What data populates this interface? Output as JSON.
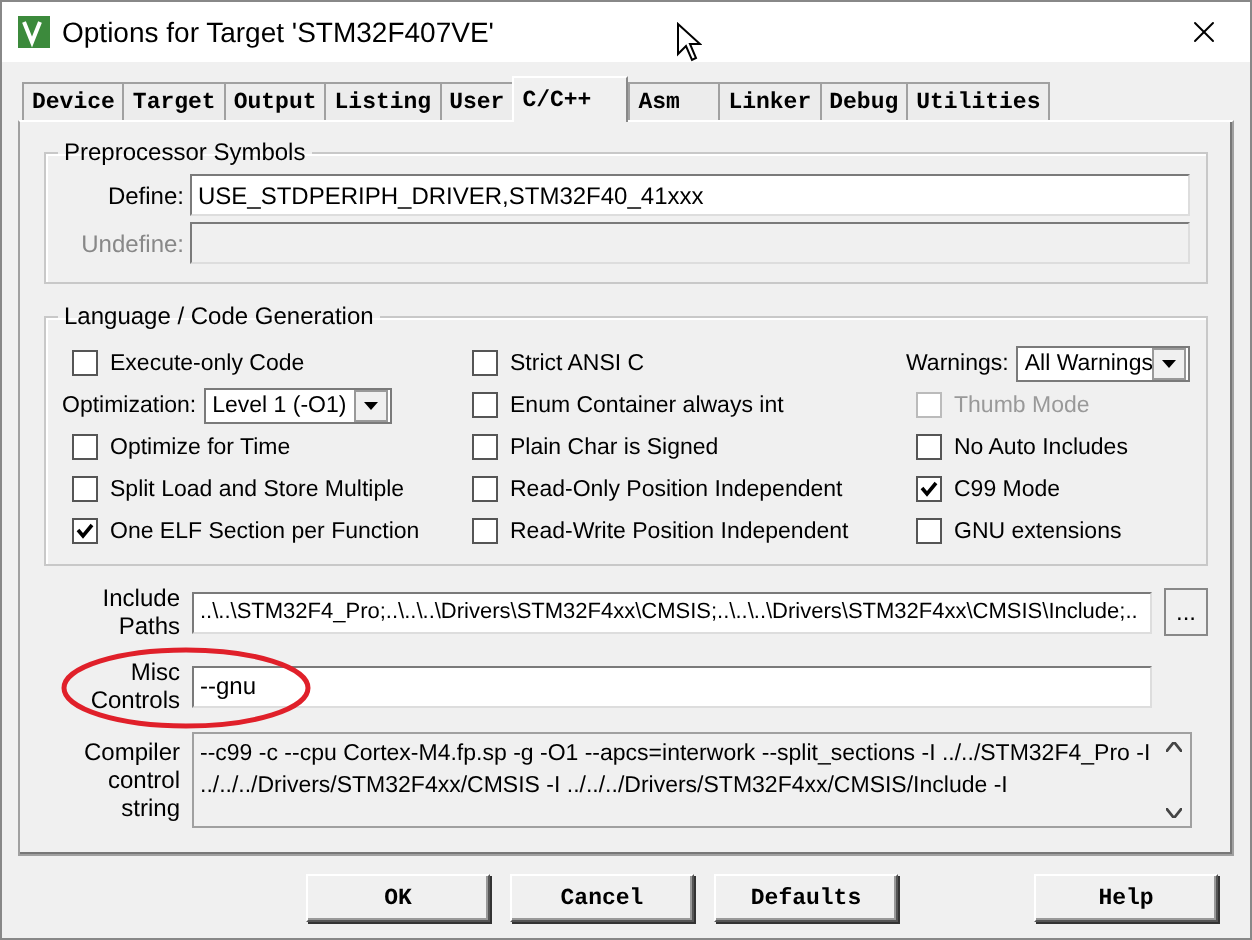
{
  "window": {
    "title": "Options for Target 'STM32F407VE'"
  },
  "tabs": [
    {
      "label": "Device",
      "selected": false
    },
    {
      "label": "Target",
      "selected": false
    },
    {
      "label": "Output",
      "selected": false
    },
    {
      "label": "Listing",
      "selected": false
    },
    {
      "label": "User",
      "selected": false
    },
    {
      "label": "C/C++",
      "selected": true
    },
    {
      "label": "Asm",
      "selected": false
    },
    {
      "label": "Linker",
      "selected": false
    },
    {
      "label": "Debug",
      "selected": false
    },
    {
      "label": "Utilities",
      "selected": false
    }
  ],
  "preprocessor": {
    "title": "Preprocessor Symbols",
    "fields": [
      {
        "label": "Define:",
        "value": "USE_STDPERIPH_DRIVER,STM32F40_41xxx",
        "disabled": false
      },
      {
        "label": "Undefine:",
        "disabled": true
      }
    ]
  },
  "language": {
    "title": "Language / Code Generation",
    "columns": [
      [
        {
          "kind": "checkbox",
          "label": "Execute-only Code",
          "checked": false,
          "disabled": false
        },
        {
          "kind": "select",
          "label": "Optimization:",
          "value": "Level 1 (-O1)"
        },
        {
          "kind": "checkbox",
          "label": "Optimize for Time",
          "checked": false,
          "disabled": false
        },
        {
          "kind": "checkbox",
          "label": "Split Load and Store Multiple",
          "checked": false,
          "disabled": false
        },
        {
          "kind": "checkbox",
          "label": "One ELF Section per Function",
          "checked": true,
          "disabled": false
        }
      ],
      [
        {
          "kind": "checkbox",
          "label": "Strict ANSI C",
          "checked": false,
          "disabled": false
        },
        {
          "kind": "checkbox",
          "label": "Enum Container always int",
          "checked": false,
          "disabled": false
        },
        {
          "kind": "checkbox",
          "label": "Plain Char is Signed",
          "checked": false,
          "disabled": false
        },
        {
          "kind": "checkbox",
          "label": "Read-Only Position Independent",
          "checked": false,
          "disabled": false
        },
        {
          "kind": "checkbox",
          "label": "Read-Write Position Independent",
          "checked": false,
          "disabled": false
        }
      ],
      [
        {
          "kind": "select",
          "label": "Warnings:",
          "value": "All Warnings"
        },
        {
          "kind": "checkbox",
          "label": "Thumb Mode",
          "checked": false,
          "disabled": true
        },
        {
          "kind": "checkbox",
          "label": "No Auto Includes",
          "checked": false,
          "disabled": false
        },
        {
          "kind": "checkbox",
          "label": "C99 Mode",
          "checked": true,
          "disabled": false
        },
        {
          "kind": "checkbox",
          "label": "GNU extensions",
          "checked": false,
          "disabled": false
        }
      ]
    ]
  },
  "include_paths": {
    "label": "Include Paths",
    "value": "..\\..\\STM32F4_Pro;..\\..\\..\\Drivers\\STM32F4xx\\CMSIS;..\\..\\..\\Drivers\\STM32F4xx\\CMSIS\\Include;..",
    "browse": "..."
  },
  "misc_controls": {
    "label": "Misc Controls",
    "value": "--gnu"
  },
  "compiler_string": {
    "label": "Compiler control string",
    "lines": [
      "--c99 -c --cpu Cortex-M4.fp.sp -g -O1 --apcs=interwork --split_sections -I ../../STM32F4_Pro -I",
      "../../../Drivers/STM32F4xx/CMSIS -I ../../../Drivers/STM32F4xx/CMSIS/Include -I"
    ]
  },
  "buttons": [
    "OK",
    "Cancel",
    "Defaults",
    "Help"
  ]
}
